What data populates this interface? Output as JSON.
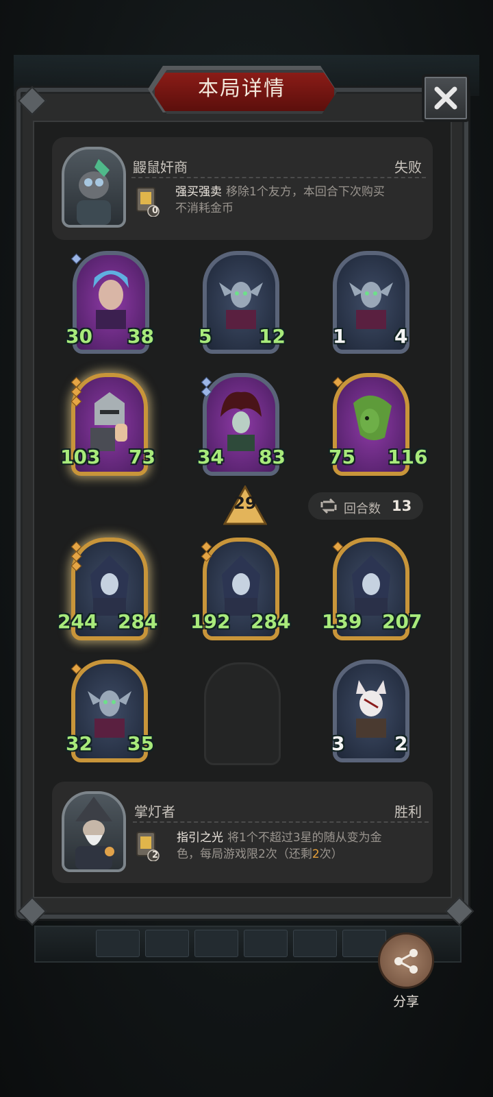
{
  "title": "本局详情",
  "opponent": {
    "name": "鼹鼠奸商",
    "result": "失败",
    "skill_name": "强买强卖",
    "skill_desc_line1": "移除1个友方，本回合下次购买",
    "skill_desc_line2": "不消耗金币",
    "skill_badge": "0"
  },
  "board_top": [
    {
      "atk": "30",
      "hp": "38",
      "frame": "purple",
      "stars": 1,
      "gem": "blue"
    },
    {
      "atk": "5",
      "hp": "12",
      "frame": "purple",
      "stars": 0,
      "gem": "none"
    },
    {
      "atk": "1",
      "hp": "4",
      "frame": "purple",
      "stars": 0,
      "gem": "none"
    },
    {
      "atk": "103",
      "hp": "73",
      "frame": "gold",
      "stars": 3,
      "gem": "gold",
      "glow": true
    },
    {
      "atk": "34",
      "hp": "83",
      "frame": "purple",
      "stars": 2,
      "gem": "blue"
    },
    {
      "atk": "75",
      "hp": "116",
      "frame": "gold",
      "stars": 1,
      "gem": "gold"
    }
  ],
  "tier": "29",
  "rounds": {
    "label": "回合数",
    "value": "13"
  },
  "board_bottom": [
    {
      "atk": "244",
      "hp": "284",
      "frame": "gold",
      "stars": 3,
      "glow": true
    },
    {
      "atk": "192",
      "hp": "284",
      "frame": "gold",
      "stars": 2
    },
    {
      "atk": "139",
      "hp": "207",
      "frame": "gold",
      "stars": 1
    },
    {
      "atk": "32",
      "hp": "35",
      "frame": "gold",
      "stars": 1
    },
    {
      "empty": true
    },
    {
      "atk": "3",
      "hp": "2",
      "frame": "purple",
      "stars": 0,
      "white_numbers": true
    }
  ],
  "self": {
    "name": "掌灯者",
    "result": "胜利",
    "skill_name": "指引之光",
    "skill_desc_line1": "将1个不超过3星的随从变为金",
    "skill_desc_line2_a": "色，每局游戏限2次（还剩",
    "skill_desc_line2_hl": "2",
    "skill_desc_line2_b": "次）",
    "skill_badge": "2"
  },
  "share_label": "分享",
  "icons": {
    "close": "close-icon",
    "share": "share-icon",
    "rounds": "cycle-arrows-icon",
    "tier": "tier-triangle-icon"
  },
  "colors": {
    "title_plate": "#8a1c17",
    "stat_green": "#a8ea7b",
    "highlight": "#e9a23a",
    "gold_frame": "#c8953a",
    "purple_frame": "#5a6479"
  }
}
